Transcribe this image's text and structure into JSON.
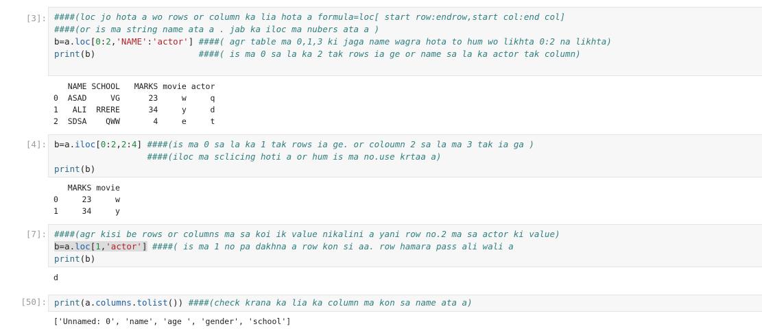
{
  "notebook": {
    "cells": [
      {
        "prompt": "[3]:",
        "code_lines": [
          "####(loc jo hota a wo rows or column ka lia hota a formula=loc[ start row:endrow,start col:end col]",
          "####(or is ma string name ata a . jab ka iloc ma nubers ata a )",
          "b=a.loc[0:2,'NAME':'actor'] ####( agr table ma 0,1,3 ki jaga name wagra hota to hum wo likhta 0:2 na likhta)",
          "print(b)                    ####( is ma 0 sa la ka 2 tak rows ia ge or name sa la ka actor tak column)"
        ],
        "output_lines": [
          "   NAME SCHOOL   MARKS movie actor",
          "0  ASAD     VG      23     w     q",
          "1   ALI  RRERE      34     y     d",
          "2  SDSA    QWW       4     e     t"
        ]
      },
      {
        "prompt": "[4]:",
        "code_lines": [
          "b=a.iloc[0:2,2:4] ####(is ma 0 sa la ka 1 tak rows ia ge. or coloumn 2 sa la ma 3 tak ia ga )",
          "                  ####(iloc ma sclicing hoti a or hum is ma no.use krtaa a)",
          "print(b)"
        ],
        "output_lines": [
          "   MARKS movie",
          "0     23     w",
          "1     34     y"
        ]
      },
      {
        "prompt": "[7]:",
        "code_lines": [
          "####(agr kisi be rows or columns ma sa koi ik value nikalini a yani row no.2 ma sa actor ki value)",
          "b=a.loc[1,'actor'] ####( is ma 1 no pa dakhna a row kon si aa. row hamara pass ali wali a",
          "print(b)"
        ],
        "output_lines": [
          "d"
        ]
      },
      {
        "prompt": "[50]:",
        "code_lines": [
          "print(a.columns.tolist()) ####(check krana ka lia ka column ma kon sa name ata a)"
        ],
        "output_lines": [
          "['Unnamed: 0', 'name', 'age ', 'gender', 'school']"
        ]
      }
    ]
  },
  "colors": {
    "comment": "#2f7f7f",
    "string": "#b0232a",
    "number": "#1e8a3a",
    "attribute": "#1d5fa8",
    "prompt": "#9a9a9a",
    "cell_background": "#f7f7f7"
  }
}
